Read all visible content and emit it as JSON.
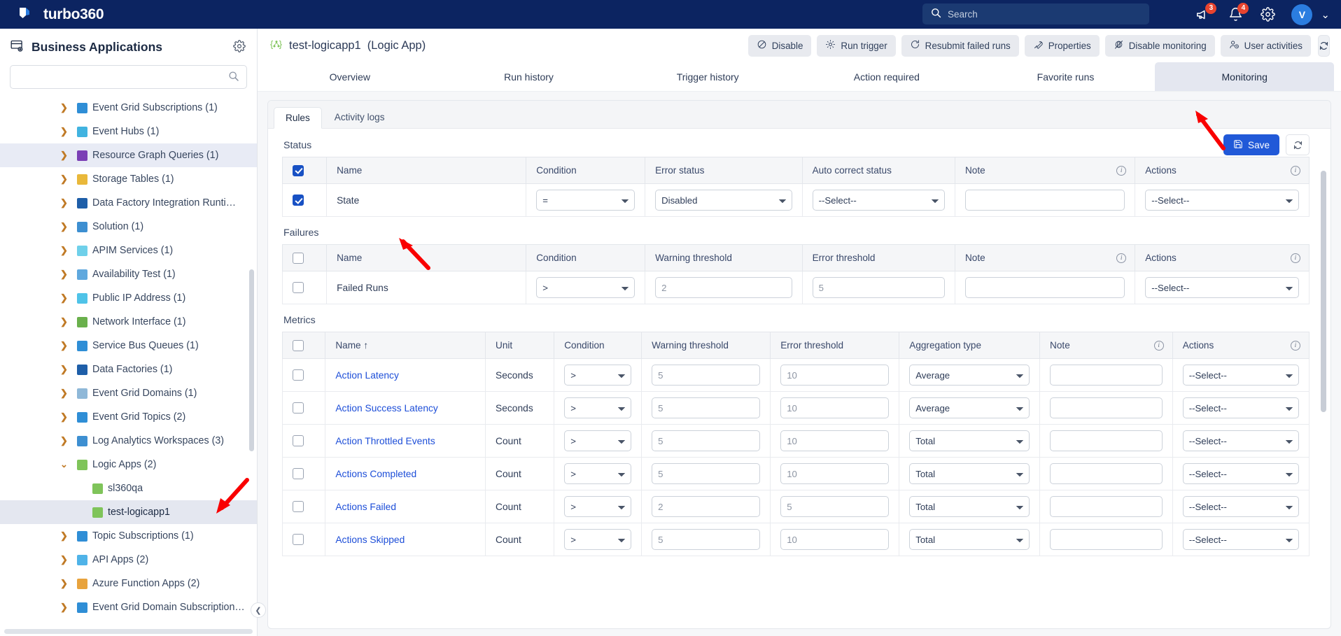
{
  "topnav": {
    "brand": "turbo360",
    "search_placeholder": "Search",
    "announcements_badge": "3",
    "notifications_badge": "4",
    "avatar_initial": "V"
  },
  "sidebar": {
    "title": "Business Applications",
    "search_value": "",
    "search_placeholder": "",
    "items": [
      {
        "label": "Event Grid Subscriptions (1)",
        "expandable": true,
        "expanded": false,
        "color": "#2f8ed6",
        "state": ""
      },
      {
        "label": "Event Hubs (1)",
        "expandable": true,
        "expanded": false,
        "color": "#41b3e0",
        "state": ""
      },
      {
        "label": "Resource Graph Queries (1)",
        "expandable": true,
        "expanded": false,
        "color": "#7b3fb5",
        "state": "highlight"
      },
      {
        "label": "Storage Tables (1)",
        "expandable": true,
        "expanded": false,
        "color": "#e9b83a",
        "state": ""
      },
      {
        "label": "Data Factory Integration Runti…",
        "expandable": true,
        "expanded": false,
        "color": "#1e5ea8",
        "state": ""
      },
      {
        "label": "Solution (1)",
        "expandable": true,
        "expanded": false,
        "color": "#3d8fd1",
        "state": ""
      },
      {
        "label": "APIM Services (1)",
        "expandable": true,
        "expanded": false,
        "color": "#6fd0ea",
        "state": ""
      },
      {
        "label": "Availability Test (1)",
        "expandable": true,
        "expanded": false,
        "color": "#5fa8de",
        "state": ""
      },
      {
        "label": "Public IP Address (1)",
        "expandable": true,
        "expanded": false,
        "color": "#4fc3e8",
        "state": ""
      },
      {
        "label": "Network Interface (1)",
        "expandable": true,
        "expanded": false,
        "color": "#6ab04c",
        "state": ""
      },
      {
        "label": "Service Bus Queues (1)",
        "expandable": true,
        "expanded": false,
        "color": "#2f8ed6",
        "state": ""
      },
      {
        "label": "Data Factories (1)",
        "expandable": true,
        "expanded": false,
        "color": "#1e5ea8",
        "state": ""
      },
      {
        "label": "Event Grid Domains (1)",
        "expandable": true,
        "expanded": false,
        "color": "#8fb8d8",
        "state": ""
      },
      {
        "label": "Event Grid Topics (2)",
        "expandable": true,
        "expanded": false,
        "color": "#2f8ed6",
        "state": ""
      },
      {
        "label": "Log Analytics Workspaces (3)",
        "expandable": true,
        "expanded": false,
        "color": "#3d8fd1",
        "state": ""
      },
      {
        "label": "Logic Apps (2)",
        "expandable": true,
        "expanded": true,
        "color": "#7fc45a",
        "state": ""
      },
      {
        "label": "sl360qa",
        "expandable": false,
        "expanded": false,
        "color": "#7fc45a",
        "state": "leaf"
      },
      {
        "label": "test-logicapp1",
        "expandable": false,
        "expanded": false,
        "color": "#7fc45a",
        "state": "selected"
      },
      {
        "label": "Topic Subscriptions (1)",
        "expandable": true,
        "expanded": false,
        "color": "#2f8ed6",
        "state": ""
      },
      {
        "label": "API Apps (2)",
        "expandable": true,
        "expanded": false,
        "color": "#4fb3e8",
        "state": ""
      },
      {
        "label": "Azure Function Apps (2)",
        "expandable": true,
        "expanded": false,
        "color": "#e8a33d",
        "state": ""
      },
      {
        "label": "Event Grid Domain Subscription…",
        "expandable": true,
        "expanded": false,
        "color": "#2f8ed6",
        "state": ""
      }
    ]
  },
  "page": {
    "resource_name": "test-logicapp1",
    "resource_type": "(Logic App)",
    "toolbar": [
      {
        "label": "Disable",
        "icon": "ban-icon"
      },
      {
        "label": "Run trigger",
        "icon": "gear-icon"
      },
      {
        "label": "Resubmit failed runs",
        "icon": "rotate-icon"
      },
      {
        "label": "Properties",
        "icon": "wrench-icon"
      },
      {
        "label": "Disable monitoring",
        "icon": "monitor-off-icon"
      },
      {
        "label": "User activities",
        "icon": "user-clock-icon"
      }
    ],
    "refresh_label": "",
    "tabs": [
      {
        "label": "Overview",
        "active": false
      },
      {
        "label": "Run history",
        "active": false
      },
      {
        "label": "Trigger history",
        "active": false
      },
      {
        "label": "Action required",
        "active": false
      },
      {
        "label": "Favorite runs",
        "active": false
      },
      {
        "label": "Monitoring",
        "active": true
      }
    ]
  },
  "monitoring": {
    "subtabs": [
      {
        "label": "Rules",
        "active": true
      },
      {
        "label": "Activity logs",
        "active": false
      }
    ],
    "save_label": "Save",
    "status": {
      "title": "Status",
      "header_checked": true,
      "columns": [
        "Name",
        "Condition",
        "Error status",
        "Auto correct status",
        "Note",
        "Actions"
      ],
      "rows": [
        {
          "checked": true,
          "name": "State",
          "condition": "=",
          "error_status": "Disabled",
          "auto_correct_status": "--Select--",
          "note": "",
          "actions": "--Select--"
        }
      ]
    },
    "failures": {
      "title": "Failures",
      "header_checked": false,
      "columns": [
        "Name",
        "Condition",
        "Warning threshold",
        "Error threshold",
        "Note",
        "Actions"
      ],
      "rows": [
        {
          "checked": false,
          "name": "Failed Runs",
          "condition": ">",
          "warning_threshold": "2",
          "error_threshold": "5",
          "note": "",
          "actions": "--Select--"
        }
      ]
    },
    "metrics": {
      "title": "Metrics",
      "header_checked": false,
      "sort_column": "Name",
      "sort_dir": "↑",
      "columns": [
        "Name",
        "Unit",
        "Condition",
        "Warning threshold",
        "Error threshold",
        "Aggregation type",
        "Note",
        "Actions"
      ],
      "rows": [
        {
          "checked": false,
          "name": "Action Latency",
          "unit": "Seconds",
          "condition": ">",
          "warning_threshold": "5",
          "error_threshold": "10",
          "aggregation_type": "Average",
          "note": "",
          "actions": "--Select--"
        },
        {
          "checked": false,
          "name": "Action Success Latency",
          "unit": "Seconds",
          "condition": ">",
          "warning_threshold": "5",
          "error_threshold": "10",
          "aggregation_type": "Average",
          "note": "",
          "actions": "--Select--"
        },
        {
          "checked": false,
          "name": "Action Throttled Events",
          "unit": "Count",
          "condition": ">",
          "warning_threshold": "5",
          "error_threshold": "10",
          "aggregation_type": "Total",
          "note": "",
          "actions": "--Select--"
        },
        {
          "checked": false,
          "name": "Actions Completed",
          "unit": "Count",
          "condition": ">",
          "warning_threshold": "5",
          "error_threshold": "10",
          "aggregation_type": "Total",
          "note": "",
          "actions": "--Select--"
        },
        {
          "checked": false,
          "name": "Actions Failed",
          "unit": "Count",
          "condition": ">",
          "warning_threshold": "2",
          "error_threshold": "5",
          "aggregation_type": "Total",
          "note": "",
          "actions": "--Select--"
        },
        {
          "checked": false,
          "name": "Actions Skipped",
          "unit": "Count",
          "condition": ">",
          "warning_threshold": "5",
          "error_threshold": "10",
          "aggregation_type": "Total",
          "note": "",
          "actions": "--Select--"
        }
      ]
    }
  },
  "colors": {
    "brand_navy": "#0c2461",
    "accent_blue": "#2159d8",
    "link_blue": "#1d4ed8",
    "badge_red": "#e8442f",
    "annotation_red": "#f90000"
  }
}
